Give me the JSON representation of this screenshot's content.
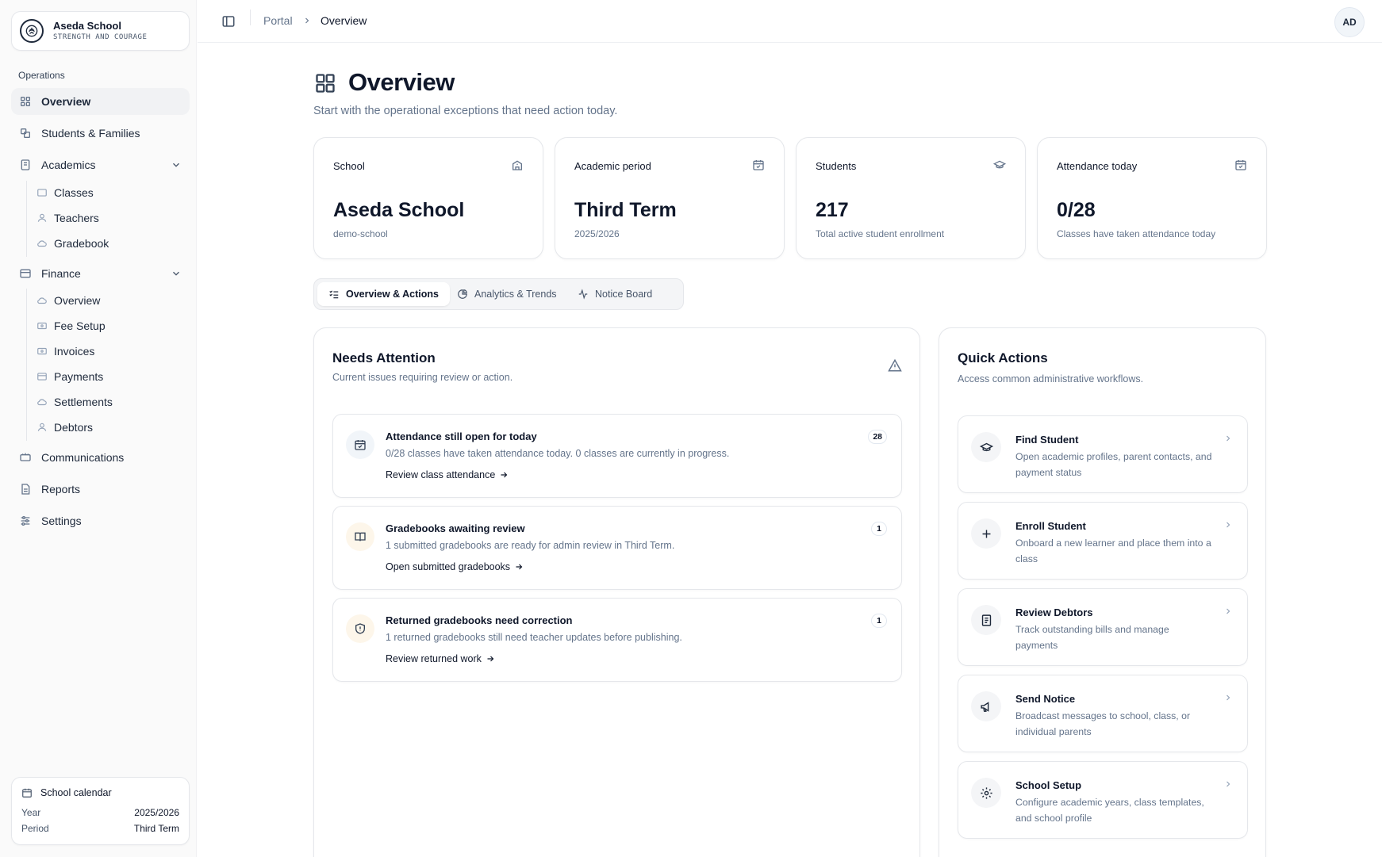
{
  "brand": {
    "name": "Aseda School",
    "motto": "STRENGTH AND COURAGE"
  },
  "sidebar": {
    "section_label": "Operations",
    "items": [
      {
        "label": "Overview",
        "icon": "grid-icon"
      },
      {
        "label": "Students & Families",
        "icon": "users-icon"
      },
      {
        "label": "Academics",
        "icon": "book-icon"
      },
      {
        "label": "Finance",
        "icon": "wallet-icon"
      },
      {
        "label": "Communications",
        "icon": "megaphone-icon"
      },
      {
        "label": "Reports",
        "icon": "file-icon"
      },
      {
        "label": "Settings",
        "icon": "sliders-icon"
      }
    ],
    "academics_sub": [
      "Classes",
      "Teachers",
      "Gradebook"
    ],
    "finance_sub": [
      "Overview",
      "Fee Setup",
      "Invoices",
      "Payments",
      "Settlements",
      "Debtors"
    ],
    "calendar": {
      "title": "School calendar",
      "year_label": "Year",
      "year_value": "2025/2026",
      "period_label": "Period",
      "period_value": "Third Term"
    }
  },
  "topbar": {
    "crumb_root": "Portal",
    "crumb_current": "Overview",
    "avatar": "AD"
  },
  "page": {
    "title": "Overview",
    "subtitle": "Start with the operational exceptions that need action today."
  },
  "stats": [
    {
      "label": "School",
      "value": "Aseda School",
      "sub": "demo-school",
      "icon": "school-icon"
    },
    {
      "label": "Academic period",
      "value": "Third Term",
      "sub": "2025/2026",
      "icon": "calendar-icon"
    },
    {
      "label": "Students",
      "value": "217",
      "sub": "Total active student enrollment",
      "icon": "graduation-cap-icon"
    },
    {
      "label": "Attendance today",
      "value": "0/28",
      "sub": "Classes have taken attendance today",
      "icon": "calendar-check-icon"
    }
  ],
  "tabs": [
    {
      "label": "Overview & Actions"
    },
    {
      "label": "Analytics & Trends"
    },
    {
      "label": "Notice Board"
    }
  ],
  "needs_attention": {
    "title": "Needs Attention",
    "subtitle": "Current issues requiring review or action.",
    "items": [
      {
        "title": "Attendance still open for today",
        "desc": "0/28 classes have taken attendance today. 0 classes are currently in progress.",
        "link": "Review class attendance",
        "count": "28",
        "tint": "#f1f5f9"
      },
      {
        "title": "Gradebooks awaiting review",
        "desc": "1 submitted gradebooks are ready for admin review in Third Term.",
        "link": "Open submitted gradebooks",
        "count": "1",
        "tint": "#fdf6ea"
      },
      {
        "title": "Returned gradebooks need correction",
        "desc": "1 returned gradebooks still need teacher updates before publishing.",
        "link": "Review returned work",
        "count": "1",
        "tint": "#fdf6ea"
      }
    ]
  },
  "quick_actions": {
    "title": "Quick Actions",
    "subtitle": "Access common administrative workflows.",
    "items": [
      {
        "title": "Find Student",
        "desc": "Open academic profiles, parent contacts, and payment status",
        "icon": "graduation-cap-icon"
      },
      {
        "title": "Enroll Student",
        "desc": "Onboard a new learner and place them into a class",
        "icon": "plus-icon"
      },
      {
        "title": "Review Debtors",
        "desc": "Track outstanding bills and manage payments",
        "icon": "receipt-icon"
      },
      {
        "title": "Send Notice",
        "desc": "Broadcast messages to school, class, or individual parents",
        "icon": "megaphone-icon"
      },
      {
        "title": "School Setup",
        "desc": "Configure academic years, class templates, and school profile",
        "icon": "gear-icon"
      }
    ]
  }
}
